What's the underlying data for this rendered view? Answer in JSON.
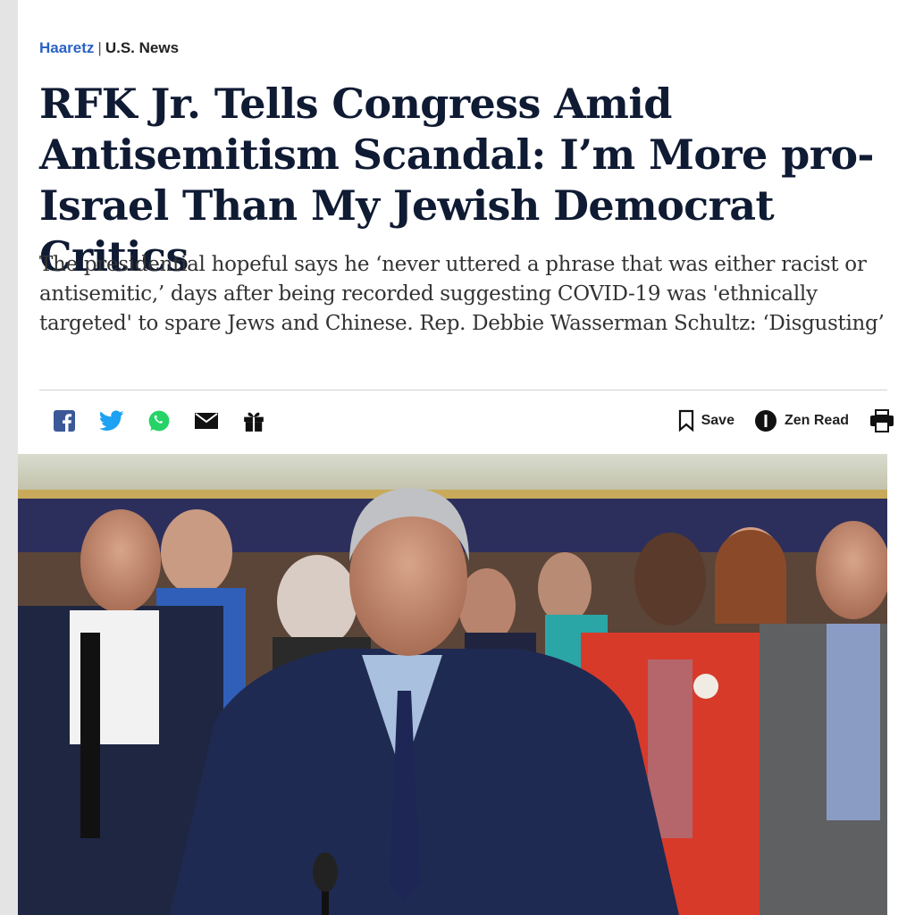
{
  "kicker": {
    "brand": "Haaretz",
    "separator": "|",
    "section": "U.S. News"
  },
  "article": {
    "headline": "RFK Jr. Tells Congress Amid Antisemitism Scandal: I’m More pro-Israel Than My Jewish Democrat Critics",
    "subhead": "The presidential hopeful says he ‘never uttered a phrase that was either racist or antisemitic,’ days after being recorded suggesting COVID-19 was 'ethnically targeted' to spare Jews and Chinese. Rep. Debbie Wasserman Schultz: ‘Disgusting’"
  },
  "share": {
    "icons": [
      "facebook-icon",
      "twitter-icon",
      "whatsapp-icon",
      "email-icon",
      "gift-icon"
    ]
  },
  "tools": {
    "save_label": "Save",
    "zen_read_label": "Zen Read",
    "print_icon": "print-icon"
  },
  "colors": {
    "brand_link": "#2b62c4",
    "headline": "#0f1a33",
    "facebook": "#3b5998",
    "twitter": "#1da1f2",
    "whatsapp": "#25d366"
  }
}
